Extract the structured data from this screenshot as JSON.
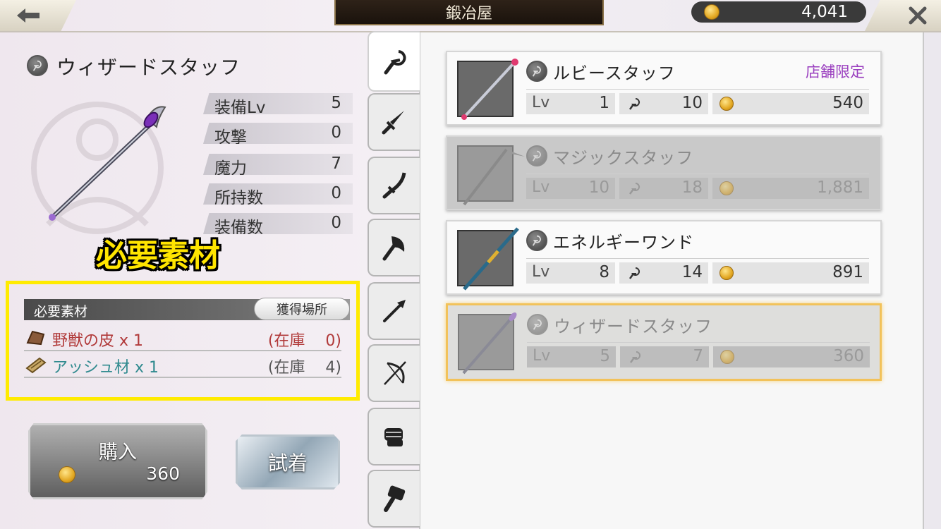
{
  "header": {
    "title": "鍛冶屋",
    "currency": "4,041"
  },
  "item": {
    "name": "ウィザードスタッフ",
    "stats": [
      {
        "label": "装備Lv",
        "value": "5"
      },
      {
        "label": "攻撃",
        "value": "0"
      },
      {
        "label": "魔力",
        "value": "7"
      },
      {
        "label": "所持数",
        "value": "0"
      },
      {
        "label": "装備数",
        "value": "0"
      }
    ]
  },
  "annotation": {
    "required_materials": "必要素材"
  },
  "materials": {
    "header": "必要素材",
    "source_button": "獲得場所",
    "rows": [
      {
        "name": "野獣の皮 x 1",
        "stock": "(在庫　 0)"
      },
      {
        "name": "アッシュ材 x 1",
        "stock": "(在庫　 4)"
      }
    ]
  },
  "actions": {
    "buy_label": "購入",
    "buy_price": "360",
    "try_label": "試着"
  },
  "tabs": [
    "staff",
    "sword",
    "katana",
    "axe",
    "spear",
    "bow",
    "glove",
    "hammer"
  ],
  "items": [
    {
      "name": "ルビースタッフ",
      "badge": "店舗限定",
      "lv": "1",
      "magic": "10",
      "price": "540",
      "state": "normal"
    },
    {
      "name": "マジックスタッフ",
      "badge": "",
      "lv": "10",
      "magic": "18",
      "price": "1,881",
      "state": "disabled"
    },
    {
      "name": "エネルギーワンド",
      "badge": "",
      "lv": "8",
      "magic": "14",
      "price": "891",
      "state": "normal"
    },
    {
      "name": "ウィザードスタッフ",
      "badge": "",
      "lv": "5",
      "magic": "7",
      "price": "360",
      "state": "selected"
    }
  ],
  "labels": {
    "lv": "Lv"
  },
  "colors": {
    "highlight": "#ffeb00",
    "limited": "#9a3fbf",
    "material_red": "#b13a3a",
    "material_teal": "#2f8a8e"
  }
}
